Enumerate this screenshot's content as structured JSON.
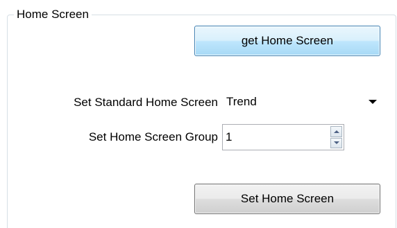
{
  "group": {
    "title": "Home Screen"
  },
  "buttons": {
    "get_label": "get Home Screen",
    "set_label": "Set Home Screen"
  },
  "standard_home_screen": {
    "label": "Set Standard Home Screen",
    "selected_value": "Trend"
  },
  "home_screen_group": {
    "label": "Set Home Screen Group",
    "value": "1"
  },
  "icons": {
    "dropdown": "chevron-down-icon",
    "spin_up": "arrow-up-icon",
    "spin_down": "arrow-down-icon"
  }
}
